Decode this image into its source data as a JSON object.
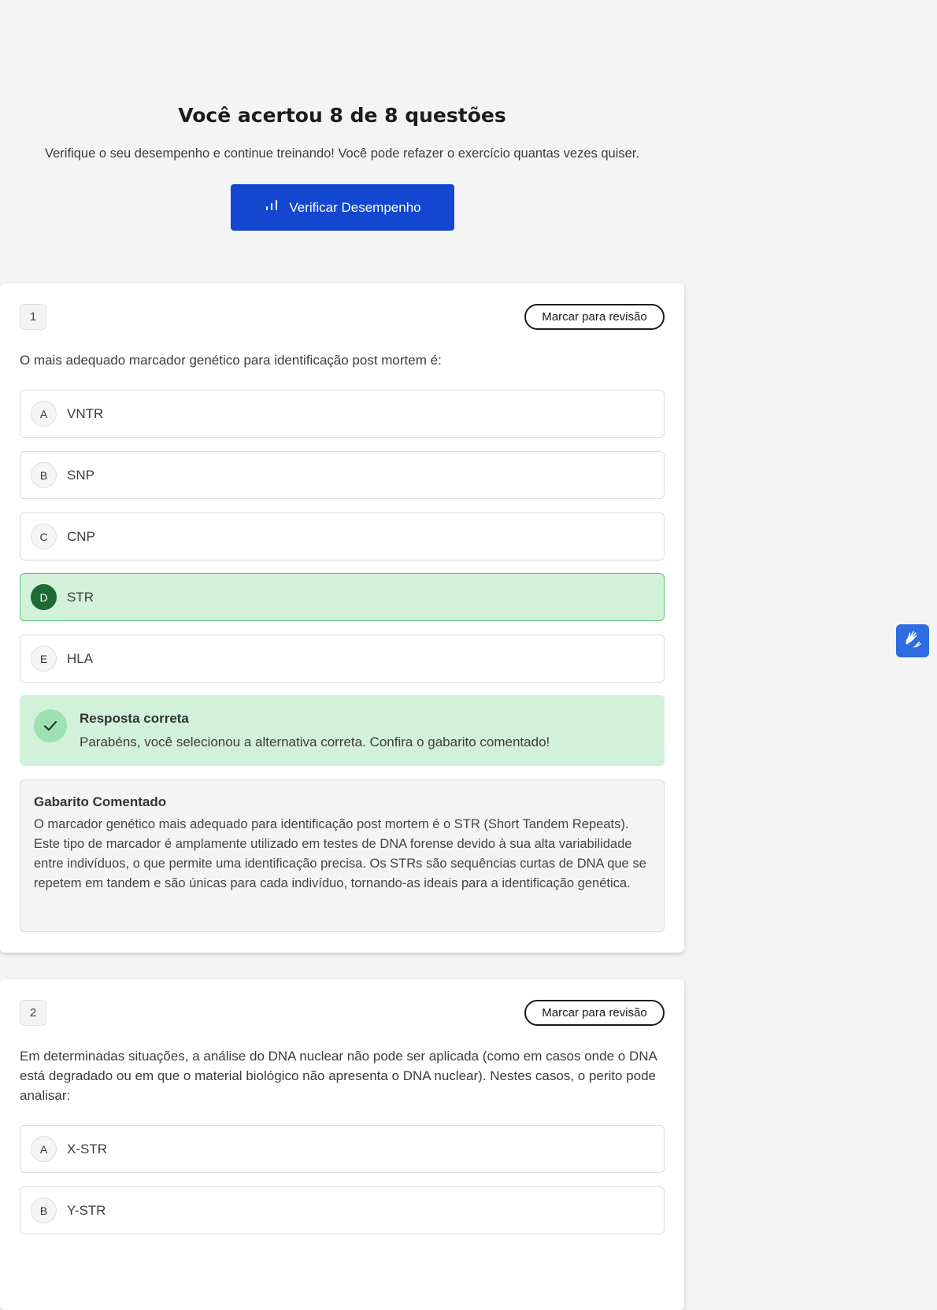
{
  "summary": {
    "title": "Você acertou 8 de 8 questões",
    "text": "Verifique o seu desempenho e continue treinando! Você pode refazer o exercício quantas vezes quiser.",
    "button_label": "Verificar Desempenho",
    "button_icon": "bar-chart-icon"
  },
  "colors": {
    "primary": "#1447d0",
    "correct_bg": "#d2f1d9",
    "correct_border": "#5ec877",
    "correct_letter": "#1e6a33"
  },
  "questions": [
    {
      "number": "1",
      "review_label": "Marcar para revisão",
      "text": "O mais adequado marcador genético para identificação post mortem é:",
      "options": [
        {
          "letter": "A",
          "text": "VNTR"
        },
        {
          "letter": "B",
          "text": "SNP"
        },
        {
          "letter": "C",
          "text": "CNP"
        },
        {
          "letter": "D",
          "text": "STR",
          "state": "correct"
        },
        {
          "letter": "E",
          "text": "HLA"
        }
      ],
      "result": {
        "title": "Resposta correta",
        "text": "Parabéns, você selecionou a alternativa correta. Confira o gabarito comentado!"
      },
      "comment": {
        "title": "Gabarito Comentado",
        "text": "O marcador genético mais adequado para identificação post mortem é o STR (Short Tandem Repeats). Este tipo de marcador é amplamente utilizado em testes de DNA forense devido à sua alta variabilidade entre indivíduos, o que permite uma identificação precisa. Os STRs são sequências curtas de DNA que se repetem em tandem e são únicas para cada indivíduo, tornando-as ideais para a identificação genética."
      }
    },
    {
      "number": "2",
      "review_label": "Marcar para revisão",
      "text": "Em determinadas situações, a análise do DNA nuclear não pode ser aplicada (como em casos onde o DNA está degradado ou em que o material biológico não apresenta o DNA nuclear). Nestes casos, o perito pode analisar:",
      "options": [
        {
          "letter": "A",
          "text": "X-STR"
        },
        {
          "letter": "B",
          "text": "Y-STR"
        }
      ]
    }
  ],
  "accessibility_widget": {
    "icon": "sign-language-hands-icon"
  }
}
